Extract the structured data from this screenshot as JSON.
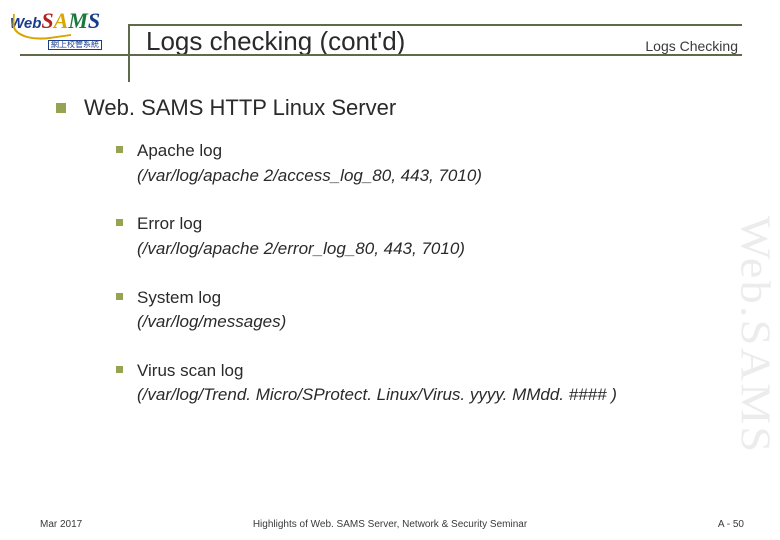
{
  "logo": {
    "web": "Web",
    "sams": "SAMS",
    "sub": "網上校管系統"
  },
  "header": {
    "title": "Logs checking (cont'd)",
    "section": "Logs Checking"
  },
  "main": {
    "heading": "Web. SAMS HTTP Linux Server",
    "items": [
      {
        "label": "Apache log",
        "path": "(/var/log/apache 2/access_log_80, 443, 7010)"
      },
      {
        "label": "Error log",
        "path": "(/var/log/apache 2/error_log_80, 443, 7010)"
      },
      {
        "label": "System log",
        "path": "(/var/log/messages)"
      },
      {
        "label": "Virus scan log",
        "path": "(/var/log/Trend. Micro/SProtect. Linux/Virus. yyyy. MMdd. #### )"
      }
    ]
  },
  "watermark": "Web.SAMS",
  "footer": {
    "left": "Mar 2017",
    "center": "Highlights of Web. SAMS Server, Network & Security Seminar",
    "right": "A - 50"
  }
}
